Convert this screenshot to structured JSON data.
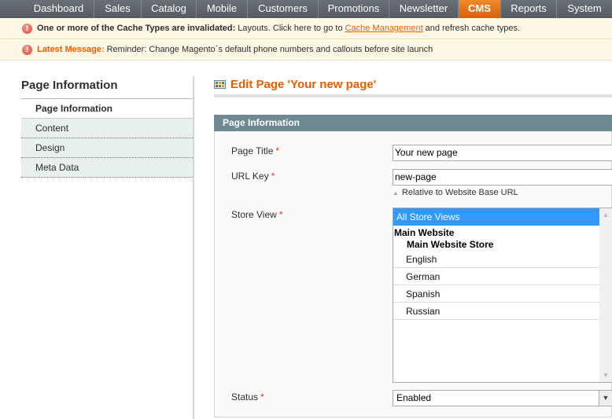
{
  "nav": {
    "tabs": [
      "Dashboard",
      "Sales",
      "Catalog",
      "Mobile",
      "Customers",
      "Promotions",
      "Newsletter",
      "CMS",
      "Reports",
      "System"
    ],
    "active": "CMS"
  },
  "alerts": {
    "cache": {
      "bold": "One or more of the Cache Types are invalidated:",
      "text1": "Layouts. Click here to go to",
      "link": "Cache Management",
      "text2": "and refresh cache types."
    },
    "latest": {
      "bold": "Latest Message:",
      "text": "Reminder: Change Magento`s default phone numbers and callouts before site launch"
    }
  },
  "sidebar": {
    "title": "Page Information",
    "items": [
      "Page Information",
      "Content",
      "Design",
      "Meta Data"
    ]
  },
  "main": {
    "title": "Edit Page 'Your new page'",
    "section": "Page Information",
    "fields": {
      "page_title": {
        "label": "Page Title",
        "value": "Your new page"
      },
      "url_key": {
        "label": "URL Key",
        "value": "new-page",
        "note": "Relative to Website Base URL"
      },
      "store_view": {
        "label": "Store View",
        "selected": "All Store Views",
        "website": "Main Website",
        "store": "Main Website Store",
        "views": [
          "English",
          "German",
          "Spanish",
          "Russian"
        ]
      },
      "status": {
        "label": "Status",
        "value": "Enabled"
      }
    },
    "required_mark": "*"
  },
  "colors": {
    "accent": "#eb5e00",
    "section_header": "#6f8992",
    "selected_option": "#3399ff"
  }
}
